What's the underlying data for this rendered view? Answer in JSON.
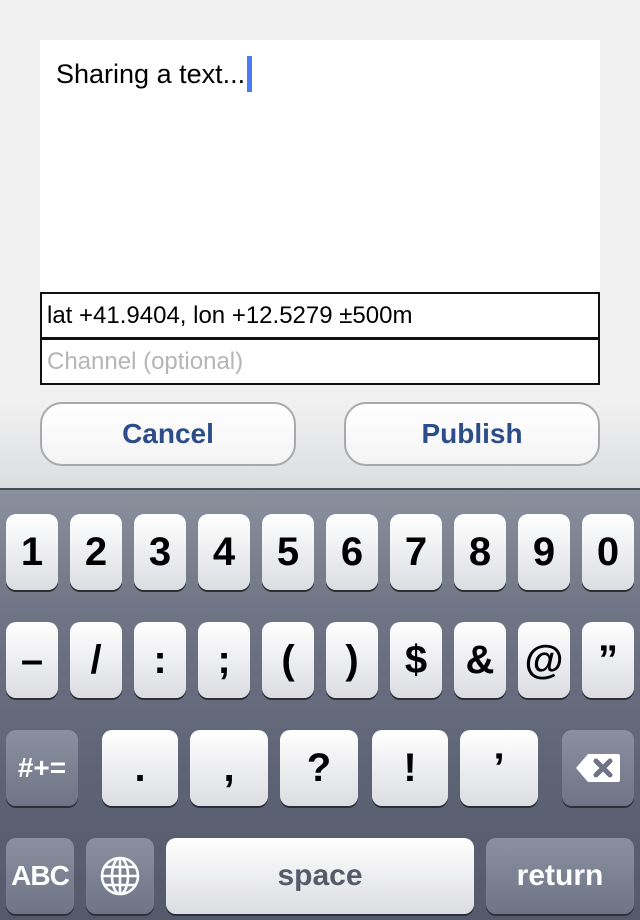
{
  "compose": {
    "text": "Sharing a text..."
  },
  "location_field": {
    "value": "lat +41.9404, lon +12.5279 ±500m"
  },
  "channel_field": {
    "placeholder": "Channel (optional)"
  },
  "buttons": {
    "cancel": "Cancel",
    "publish": "Publish"
  },
  "keyboard": {
    "row1": [
      "1",
      "2",
      "3",
      "4",
      "5",
      "6",
      "7",
      "8",
      "9",
      "0"
    ],
    "row2": [
      "–",
      "/",
      ":",
      ";",
      "(",
      ")",
      "$",
      "&",
      "@",
      "”"
    ],
    "row3": {
      "toggle": "#+=",
      "keys": [
        ".",
        ",",
        "?",
        "!",
        "’"
      ],
      "delete_icon": "backspace-icon"
    },
    "row4": {
      "abc": "ABC",
      "globe_icon": "globe-icon",
      "space": "space",
      "return": "return"
    }
  },
  "colors": {
    "button_text": "#2d4d88",
    "caret": "#4a7cf7",
    "placeholder": "#b5b5b5"
  }
}
